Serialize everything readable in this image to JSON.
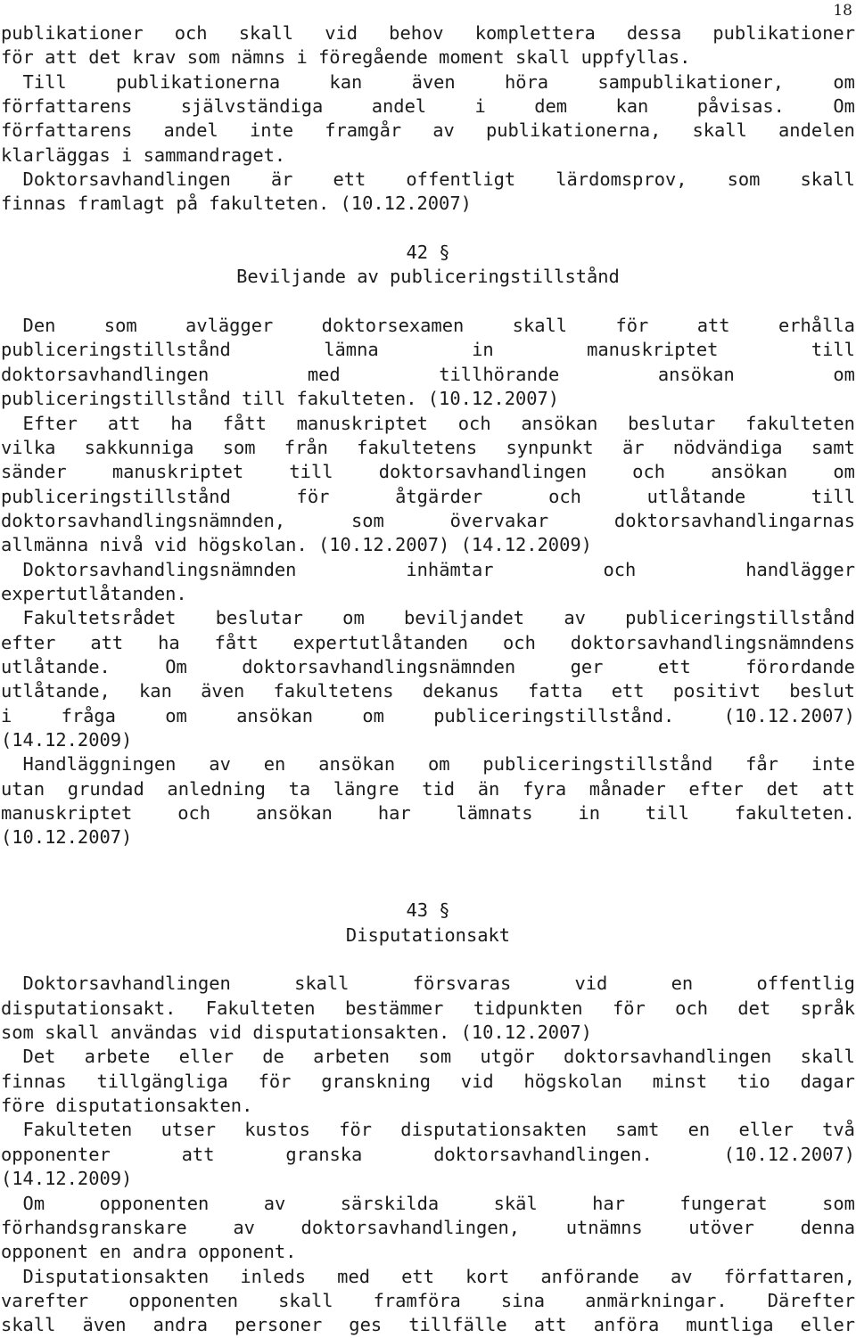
{
  "page": {
    "number": "18",
    "language": "sv",
    "background_color": "#ffffff",
    "text_color": "#1c1c1c"
  },
  "blocks": [
    {
      "type": "paragraph",
      "name": "paragraph-publikationer",
      "lines": [
        {
          "words": [
            "publikationer",
            "och",
            "skall",
            "vid",
            "behov",
            "komplettera",
            "dessa",
            "publikationer"
          ],
          "justify": true
        },
        {
          "text": "för att det krav som nämns i föregående moment skall uppfyllas.",
          "justify": false
        }
      ]
    },
    {
      "type": "paragraph",
      "name": "paragraph-till-publikationerna",
      "lines": [
        {
          "words": [
            "  Till",
            "publikationerna",
            "kan",
            "även",
            "höra",
            "sampublikationer,",
            "om"
          ],
          "justify": true
        },
        {
          "words": [
            "författarens",
            "självständiga",
            "andel",
            "i",
            "dem",
            "kan",
            "påvisas.",
            "Om"
          ],
          "justify": true
        },
        {
          "words": [
            "författarens",
            "andel",
            "inte",
            "framgår",
            "av",
            "publikationerna,",
            "skall",
            "andelen"
          ],
          "justify": true
        },
        {
          "text": "klarläggas i sammandraget.",
          "justify": false
        }
      ]
    },
    {
      "type": "paragraph",
      "name": "paragraph-doktorsavhandlingen-lardomsprov",
      "lines": [
        {
          "words": [
            "  Doktorsavhandlingen",
            "är",
            "ett",
            "offentligt",
            "lärdomsprov,",
            "som",
            "skall"
          ],
          "justify": true
        },
        {
          "text": "finnas framlagt på fakulteten. (10.12.2007)",
          "justify": false
        }
      ]
    },
    {
      "type": "blank",
      "name": "spacer-before-section-42",
      "count": 1
    },
    {
      "type": "heading",
      "name": "section-heading-42",
      "number": "42 §",
      "title": "Beviljande av publiceringstillstånd"
    },
    {
      "type": "blank",
      "name": "spacer-after-section-42",
      "count": 1
    },
    {
      "type": "paragraph",
      "name": "paragraph-den-som-avlagger",
      "lines": [
        {
          "words": [
            "  Den",
            "som",
            "avlägger",
            "doktorsexamen",
            "skall",
            "för",
            "att",
            "erhålla"
          ],
          "justify": true
        },
        {
          "words": [
            "publiceringstillstånd",
            "lämna",
            "in",
            "manuskriptet",
            "till"
          ],
          "justify": true
        },
        {
          "words": [
            "doktorsavhandlingen",
            "med",
            "tillhörande",
            "ansökan",
            "om"
          ],
          "justify": true
        },
        {
          "text": "publiceringstillstånd till fakulteten. (10.12.2007)",
          "justify": false
        }
      ]
    },
    {
      "type": "paragraph",
      "name": "paragraph-efter-att-ha-fatt",
      "lines": [
        {
          "words": [
            "  Efter",
            "att",
            "ha",
            "fått",
            "manuskriptet",
            "och",
            "ansökan",
            "beslutar",
            "fakulteten"
          ],
          "justify": true
        },
        {
          "words": [
            "vilka",
            "sakkunniga",
            "som",
            "från",
            "fakultetens",
            "synpunkt",
            "är",
            "nödvändiga",
            "samt"
          ],
          "justify": true
        },
        {
          "words": [
            "sänder",
            "manuskriptet",
            "till",
            "doktorsavhandlingen",
            "och",
            "ansökan",
            "om"
          ],
          "justify": true
        },
        {
          "words": [
            "publiceringstillstånd",
            "för",
            "åtgärder",
            "och",
            "utlåtande",
            "till"
          ],
          "justify": true
        },
        {
          "words": [
            "doktorsavhandlingsnämnden,",
            "som",
            "övervakar",
            "doktorsavhandlingarnas"
          ],
          "justify": true
        },
        {
          "text": "allmänna nivå vid högskolan. (10.12.2007) (14.12.2009)",
          "justify": false
        }
      ]
    },
    {
      "type": "paragraph",
      "name": "paragraph-doktorsavhandlingsnamnden-inhamtar",
      "lines": [
        {
          "words": [
            "  Doktorsavhandlingsnämnden",
            "inhämtar",
            "och",
            "handlägger"
          ],
          "justify": true
        },
        {
          "text": "expertutlåtanden.",
          "justify": false
        }
      ]
    },
    {
      "type": "paragraph",
      "name": "paragraph-fakultetsradet-beslutar",
      "lines": [
        {
          "words": [
            "  Fakultetsrådet",
            "beslutar",
            "om",
            "beviljandet",
            "av",
            "publiceringstillstånd"
          ],
          "justify": true
        },
        {
          "words": [
            "efter",
            "att",
            "ha",
            "fått",
            "expertutlåtanden",
            "och",
            "doktorsavhandlingsnämndens"
          ],
          "justify": true
        },
        {
          "words": [
            "utlåtande.",
            "Om",
            "doktorsavhandlingsnämnden",
            "ger",
            "ett",
            "förordande"
          ],
          "justify": true
        },
        {
          "words": [
            "utlåtande,",
            "kan",
            "även",
            "fakultetens",
            "dekanus",
            "fatta",
            "ett",
            "positivt",
            "beslut"
          ],
          "justify": true
        },
        {
          "words": [
            "i",
            "fråga",
            "om",
            "ansökan",
            "om",
            "publiceringstillstånd.",
            "(10.12.2007)"
          ],
          "justify": true
        },
        {
          "text": "(14.12.2009)",
          "justify": false
        }
      ]
    },
    {
      "type": "paragraph",
      "name": "paragraph-handlaggningen-av-en-ansokan",
      "lines": [
        {
          "words": [
            "  Handläggningen",
            "av",
            "en",
            "ansökan",
            "om",
            "publiceringstillstånd",
            "får",
            "inte"
          ],
          "justify": true
        },
        {
          "words": [
            "utan",
            "grundad",
            "anledning",
            "ta",
            "längre",
            "tid",
            "än",
            "fyra",
            "månader",
            "efter",
            "det",
            "att"
          ],
          "justify": true
        },
        {
          "words": [
            "manuskriptet",
            "och",
            "ansökan",
            "har",
            "lämnats",
            "in",
            "till",
            "fakulteten."
          ],
          "justify": true
        },
        {
          "text": "(10.12.2007)",
          "justify": false
        }
      ]
    },
    {
      "type": "blank",
      "name": "spacer-before-section-43",
      "count": 2
    },
    {
      "type": "heading",
      "name": "section-heading-43",
      "number": "43 §",
      "title": "Disputationsakt"
    },
    {
      "type": "blank",
      "name": "spacer-after-section-43",
      "count": 1
    },
    {
      "type": "paragraph",
      "name": "paragraph-doktorsavhandlingen-forsvaras",
      "lines": [
        {
          "words": [
            "  Doktorsavhandlingen",
            "skall",
            "försvaras",
            "vid",
            "en",
            "offentlig"
          ],
          "justify": true
        },
        {
          "words": [
            "disputationsakt.",
            "Fakulteten",
            "bestämmer",
            "tidpunkten",
            "för",
            "och",
            "det",
            "språk"
          ],
          "justify": true
        },
        {
          "text": "som skall användas vid disputationsakten. (10.12.2007)",
          "justify": false
        }
      ]
    },
    {
      "type": "paragraph",
      "name": "paragraph-det-arbete-eller-de-arbeten",
      "lines": [
        {
          "words": [
            "  Det",
            "arbete",
            "eller",
            "de",
            "arbeten",
            "som",
            "utgör",
            "doktorsavhandlingen",
            "skall"
          ],
          "justify": true
        },
        {
          "words": [
            "finnas",
            "tillgängliga",
            "för",
            "granskning",
            "vid",
            "högskolan",
            "minst",
            "tio",
            "dagar"
          ],
          "justify": true
        },
        {
          "text": "före disputationsakten.",
          "justify": false
        }
      ]
    },
    {
      "type": "paragraph",
      "name": "paragraph-fakulteten-utser-kustos",
      "lines": [
        {
          "words": [
            "  Fakulteten",
            "utser",
            "kustos",
            "för",
            "disputationsakten",
            "samt",
            "en",
            "eller",
            "två"
          ],
          "justify": true
        },
        {
          "words": [
            "opponenter",
            "att",
            "granska",
            "doktorsavhandlingen.",
            "(10.12.2007)"
          ],
          "justify": true
        },
        {
          "text": "(14.12.2009)",
          "justify": false
        }
      ]
    },
    {
      "type": "paragraph",
      "name": "paragraph-om-opponenten-av-sarskilda-skal",
      "lines": [
        {
          "words": [
            "  Om",
            "opponenten",
            "av",
            "särskilda",
            "skäl",
            "har",
            "fungerat",
            "som"
          ],
          "justify": true
        },
        {
          "words": [
            "förhandsgranskare",
            "av",
            "doktorsavhandlingen,",
            "utnämns",
            "utöver",
            "denna"
          ],
          "justify": true
        },
        {
          "text": "opponent en andra opponent.",
          "justify": false
        }
      ]
    },
    {
      "type": "paragraph",
      "name": "paragraph-disputationsakten-inleds",
      "lines": [
        {
          "words": [
            "  Disputationsakten",
            "inleds",
            "med",
            "ett",
            "kort",
            "anförande",
            "av",
            "författaren,"
          ],
          "justify": true
        },
        {
          "words": [
            "varefter",
            "opponenten",
            "skall",
            "framföra",
            "sina",
            "anmärkningar.",
            "Därefter"
          ],
          "justify": true
        },
        {
          "words": [
            "skall",
            "även",
            "andra",
            "personer",
            "ges",
            "tillfälle",
            "att",
            "anföra",
            "muntliga",
            "eller"
          ],
          "justify": true
        }
      ]
    }
  ]
}
